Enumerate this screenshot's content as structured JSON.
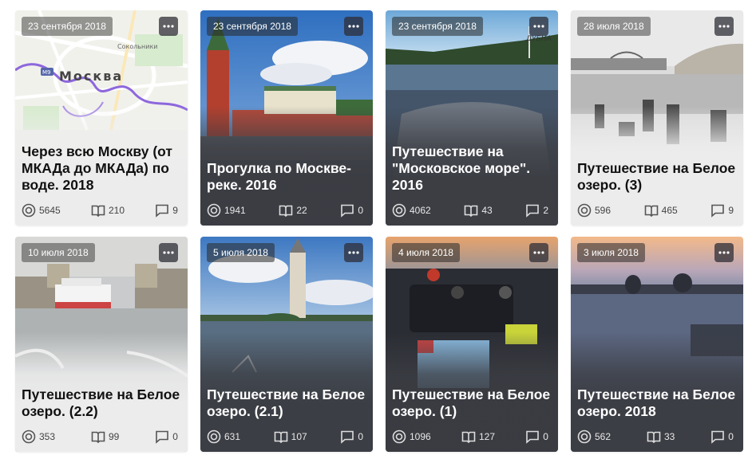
{
  "cards": [
    {
      "date": "23 сентября 2018",
      "title": "Через всю Москву (от МКАДа до МКАДа) по воде. 2018",
      "views": "5645",
      "reads": "210",
      "comments": "9",
      "map_label": "Москва",
      "map_sublabel": "Сокольники",
      "map_route": "М9"
    },
    {
      "date": "23 сентября 2018",
      "title": "Прогулка по Москве-реке. 2016",
      "views": "1941",
      "reads": "22",
      "comments": "0"
    },
    {
      "date": "23 сентября 2018",
      "title": "Путешествие на \"Московское море\". 2016",
      "views": "4062",
      "reads": "43",
      "comments": "2",
      "sign_text": "ДУБНА"
    },
    {
      "date": "28 июля 2018",
      "title": "Путешествие на Белое озеро. (3)",
      "views": "596",
      "reads": "465",
      "comments": "9"
    },
    {
      "date": "10 июля 2018",
      "title": "Путешествие на Белое озеро. (2.2)",
      "views": "353",
      "reads": "99",
      "comments": "0"
    },
    {
      "date": "5 июля 2018",
      "title": "Путешествие на Белое озеро. (2.1)",
      "views": "631",
      "reads": "107",
      "comments": "0"
    },
    {
      "date": "4 июля 2018",
      "title": "Путешествие на Белое озеро. (1)",
      "views": "1096",
      "reads": "127",
      "comments": "0"
    },
    {
      "date": "3 июля 2018",
      "title": "Путешествие на Белое озеро. 2018",
      "views": "562",
      "reads": "33",
      "comments": "0"
    }
  ],
  "icons": {
    "more": "more-dots-icon",
    "views": "eye-circle-icon",
    "reads": "open-book-icon",
    "comments": "comment-bubble-icon"
  }
}
